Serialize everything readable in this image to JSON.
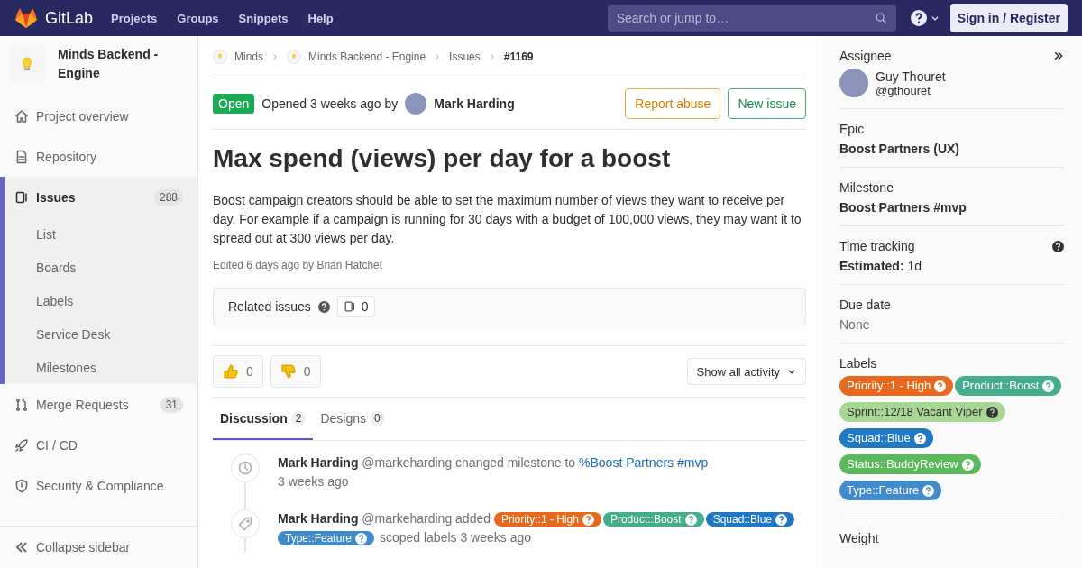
{
  "header": {
    "brand": "GitLab",
    "nav": [
      "Projects",
      "Groups",
      "Snippets",
      "Help"
    ],
    "search": {
      "placeholder": "Search or jump to…"
    },
    "sign_in": "Sign in / Register"
  },
  "sidebar": {
    "project": "Minds Backend - Engine",
    "items": [
      {
        "label": "Project overview",
        "selected": false
      },
      {
        "label": "Repository",
        "selected": false
      },
      {
        "label": "Issues",
        "selected": true,
        "count": "288",
        "children": [
          {
            "label": "List"
          },
          {
            "label": "Boards"
          },
          {
            "label": "Labels"
          },
          {
            "label": "Service Desk"
          },
          {
            "label": "Milestones"
          }
        ]
      },
      {
        "label": "Merge Requests",
        "selected": false,
        "count": "31"
      },
      {
        "label": "CI / CD",
        "selected": false
      },
      {
        "label": "Security & Compliance",
        "selected": false
      }
    ],
    "collapse": "Collapse sidebar"
  },
  "breadcrumbs": [
    {
      "label": "Minds",
      "kind": "project"
    },
    {
      "label": "Minds Backend - Engine",
      "kind": "project"
    },
    {
      "label": "Issues",
      "kind": "plain"
    },
    {
      "label": "#1169",
      "kind": "current"
    }
  ],
  "issue": {
    "status": "Open",
    "opened": "Opened 3 weeks ago by",
    "author": "Mark Harding",
    "actions": [
      {
        "label": "Report abuse",
        "kind": "warning"
      },
      {
        "label": "New issue",
        "kind": "success"
      }
    ],
    "title": "Max spend (views) per day for a boost",
    "description": "Boost campaign creators should be able to set the maximum number of views they want to receive per day. For example if a campaign is running for 30 days with a budget of 100,000 views, they may want it to spread out at 300 views per day.",
    "edited": "Edited 6 days ago by Brian Hatchet",
    "related": {
      "label": "Related issues",
      "count": "0"
    },
    "awards": [
      {
        "kind": "thumbsup",
        "count": "0"
      },
      {
        "kind": "thumbsdown",
        "count": "0"
      }
    ],
    "activity_filter": "Show all activity",
    "tabs": [
      {
        "label": "Discussion",
        "count": "2",
        "selected": true
      },
      {
        "label": "Designs",
        "count": "0",
        "selected": false
      }
    ],
    "events": [
      {
        "kind": "milestone",
        "author": "Mark Harding",
        "text": "@markeharding changed milestone to",
        "link": "%Boost Partners #mvp",
        "time": "3 weeks ago"
      },
      {
        "kind": "labels",
        "author": "Mark Harding",
        "text": "@markeharding added",
        "labels": [
          {
            "name": "Priority::1 - High",
            "color": "#e8691d"
          },
          {
            "name": "Product::Boost",
            "color": "#44ad8e"
          },
          {
            "name": "Squad::Blue",
            "color": "#1f78c1"
          },
          {
            "name": "Type::Feature",
            "color": "#428bca"
          }
        ],
        "time": "scoped labels 3 weeks ago"
      }
    ]
  },
  "right_sidebar": {
    "assignee": {
      "heading": "Assignee",
      "name": "Guy Thouret",
      "handle": "@gthouret"
    },
    "epic": {
      "heading": "Epic",
      "value": "Boost Partners (UX)"
    },
    "milestone": {
      "heading": "Milestone",
      "value": "Boost Partners #mvp"
    },
    "time_tracking": {
      "heading": "Time tracking",
      "value": "**Estimated:** 1d"
    },
    "due_date": {
      "heading": "Due date",
      "value": "None"
    },
    "labels": {
      "heading": "Labels",
      "items": [
        {
          "name": "Priority::1 - High",
          "color": "#e8691d"
        },
        {
          "name": "Product::Boost",
          "color": "#44ad8e"
        },
        {
          "name": "Sprint::12/18 Vacant Viper",
          "color": "#a8d695"
        },
        {
          "name": "Squad::Blue",
          "color": "#1f78c1"
        },
        {
          "name": "Status::BuddyReview",
          "color": "#5cb85c"
        },
        {
          "name": "Type::Feature",
          "color": "#428bca"
        }
      ]
    },
    "weight": {
      "heading": "Weight"
    }
  }
}
